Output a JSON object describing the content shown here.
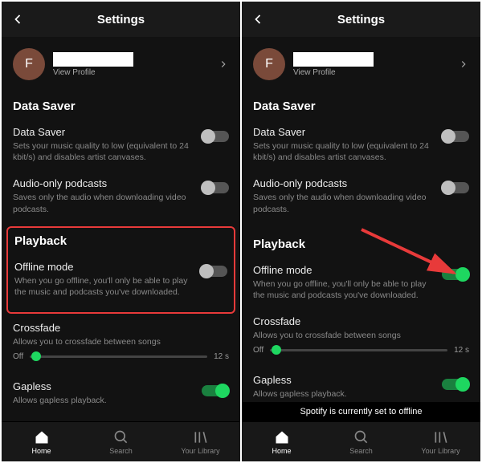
{
  "header": {
    "title": "Settings"
  },
  "profile": {
    "initial": "F",
    "view_profile": "View Profile"
  },
  "sections": {
    "data_saver_header": "Data Saver",
    "data_saver": {
      "title": "Data Saver",
      "desc": "Sets your music quality to low (equivalent to 24 kbit/s) and disables artist canvases."
    },
    "audio_only": {
      "title": "Audio-only podcasts",
      "desc": "Saves only the audio when downloading video podcasts."
    },
    "playback_header": "Playback",
    "offline": {
      "title": "Offline mode",
      "desc": "When you go offline, you'll only be able to play the music and podcasts you've downloaded."
    },
    "crossfade": {
      "title": "Crossfade",
      "desc": "Allows you to crossfade between songs"
    },
    "crossfade_min": "Off",
    "crossfade_max": "12 s",
    "gapless": {
      "title": "Gapless",
      "desc": "Allows gapless playback."
    }
  },
  "nav": {
    "home": "Home",
    "search": "Search",
    "library": "Your Library"
  },
  "toast": "Spotify is currently set to offline"
}
